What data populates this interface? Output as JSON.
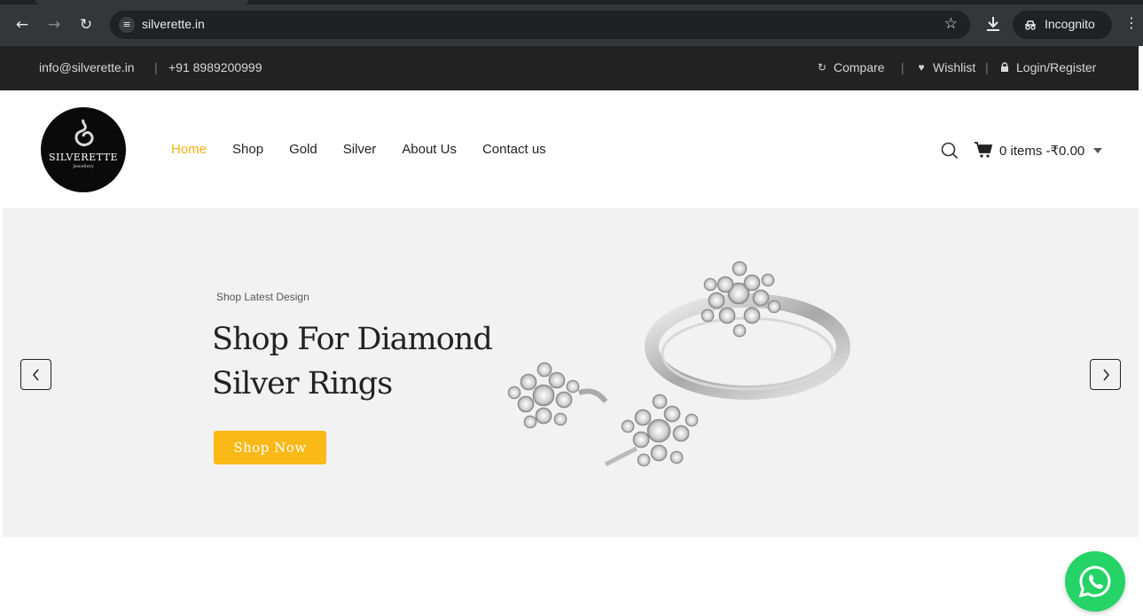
{
  "browser": {
    "url": "silverette.in",
    "incognito_label": "Incognito"
  },
  "topbar": {
    "email": "info@silverette.in",
    "separator": "|",
    "phone": "+91 8989200999",
    "compare": "Compare",
    "wishlist": "Wishlist",
    "login": "Login/Register"
  },
  "header": {
    "logo_text": "SILVERETTE",
    "logo_sub": "Jewellery",
    "nav": [
      {
        "label": "Home",
        "active": true
      },
      {
        "label": "Shop"
      },
      {
        "label": "Gold"
      },
      {
        "label": "Silver"
      },
      {
        "label": "About Us"
      },
      {
        "label": "Contact us"
      }
    ],
    "cart_label": "0 items -₹0.00",
    "accent_color": "#f5b014"
  },
  "hero": {
    "kicker": "Shop Latest Design",
    "title": "Shop For Diamond Silver Rings",
    "button": "Shop Now",
    "button_color": "#fbb917"
  },
  "icons": [
    "back-icon",
    "forward-icon",
    "reload-icon",
    "site-info-icon",
    "star-icon",
    "download-icon",
    "incognito-icon",
    "menu-icon",
    "compare-icon",
    "heart-icon",
    "lock-icon",
    "search-icon",
    "cart-icon",
    "chevron-left-icon",
    "chevron-right-icon",
    "whatsapp-icon"
  ]
}
